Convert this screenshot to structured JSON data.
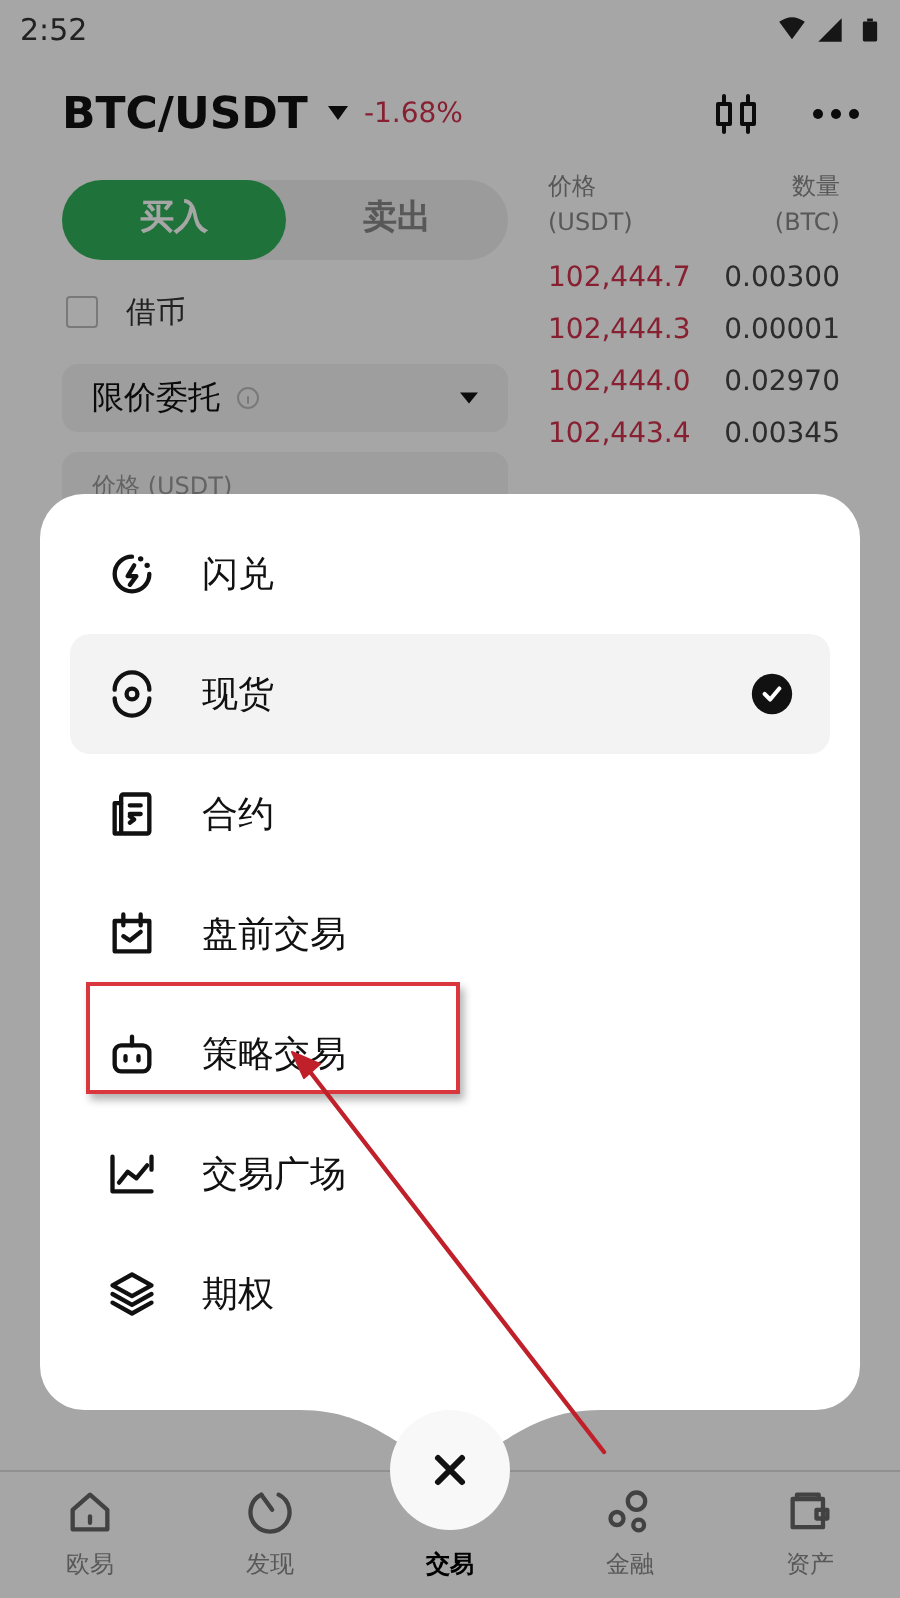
{
  "status_bar": {
    "time": "2:52"
  },
  "header": {
    "pair": "BTC/USDT",
    "change": "-1.68%"
  },
  "trade_tabs": [
    {
      "label": "买入",
      "selected": true
    },
    {
      "label": "卖出",
      "selected": false
    }
  ],
  "margin": {
    "label": "借币",
    "checked": false
  },
  "order_type": {
    "value": "限价委托"
  },
  "price_field": {
    "placeholder": "价格 (USDT)"
  },
  "order_book": {
    "columns": [
      {
        "title": "价格",
        "unit": "(USDT)"
      },
      {
        "title": "数量",
        "unit": "(BTC)"
      }
    ],
    "rows": [
      {
        "price": "102,444.7",
        "amount": "0.00300"
      },
      {
        "price": "102,444.3",
        "amount": "0.00001"
      },
      {
        "price": "102,444.0",
        "amount": "0.02970"
      },
      {
        "price": "102,443.4",
        "amount": "0.00345"
      }
    ]
  },
  "menu": [
    {
      "label": "闪兑",
      "selected": false,
      "highlighted": false
    },
    {
      "label": "现货",
      "selected": true,
      "highlighted": false
    },
    {
      "label": "合约",
      "selected": false,
      "highlighted": false
    },
    {
      "label": "盘前交易",
      "selected": false,
      "highlighted": false
    },
    {
      "label": "策略交易",
      "selected": false,
      "highlighted": true
    },
    {
      "label": "交易广场",
      "selected": false,
      "highlighted": false
    },
    {
      "label": "期权",
      "selected": false,
      "highlighted": false
    }
  ],
  "bottom_nav": [
    {
      "label": "欧易",
      "selected": false
    },
    {
      "label": "发现",
      "selected": false
    },
    {
      "label": "交易",
      "selected": true
    },
    {
      "label": "金融",
      "selected": false
    },
    {
      "label": "资产",
      "selected": false
    }
  ]
}
